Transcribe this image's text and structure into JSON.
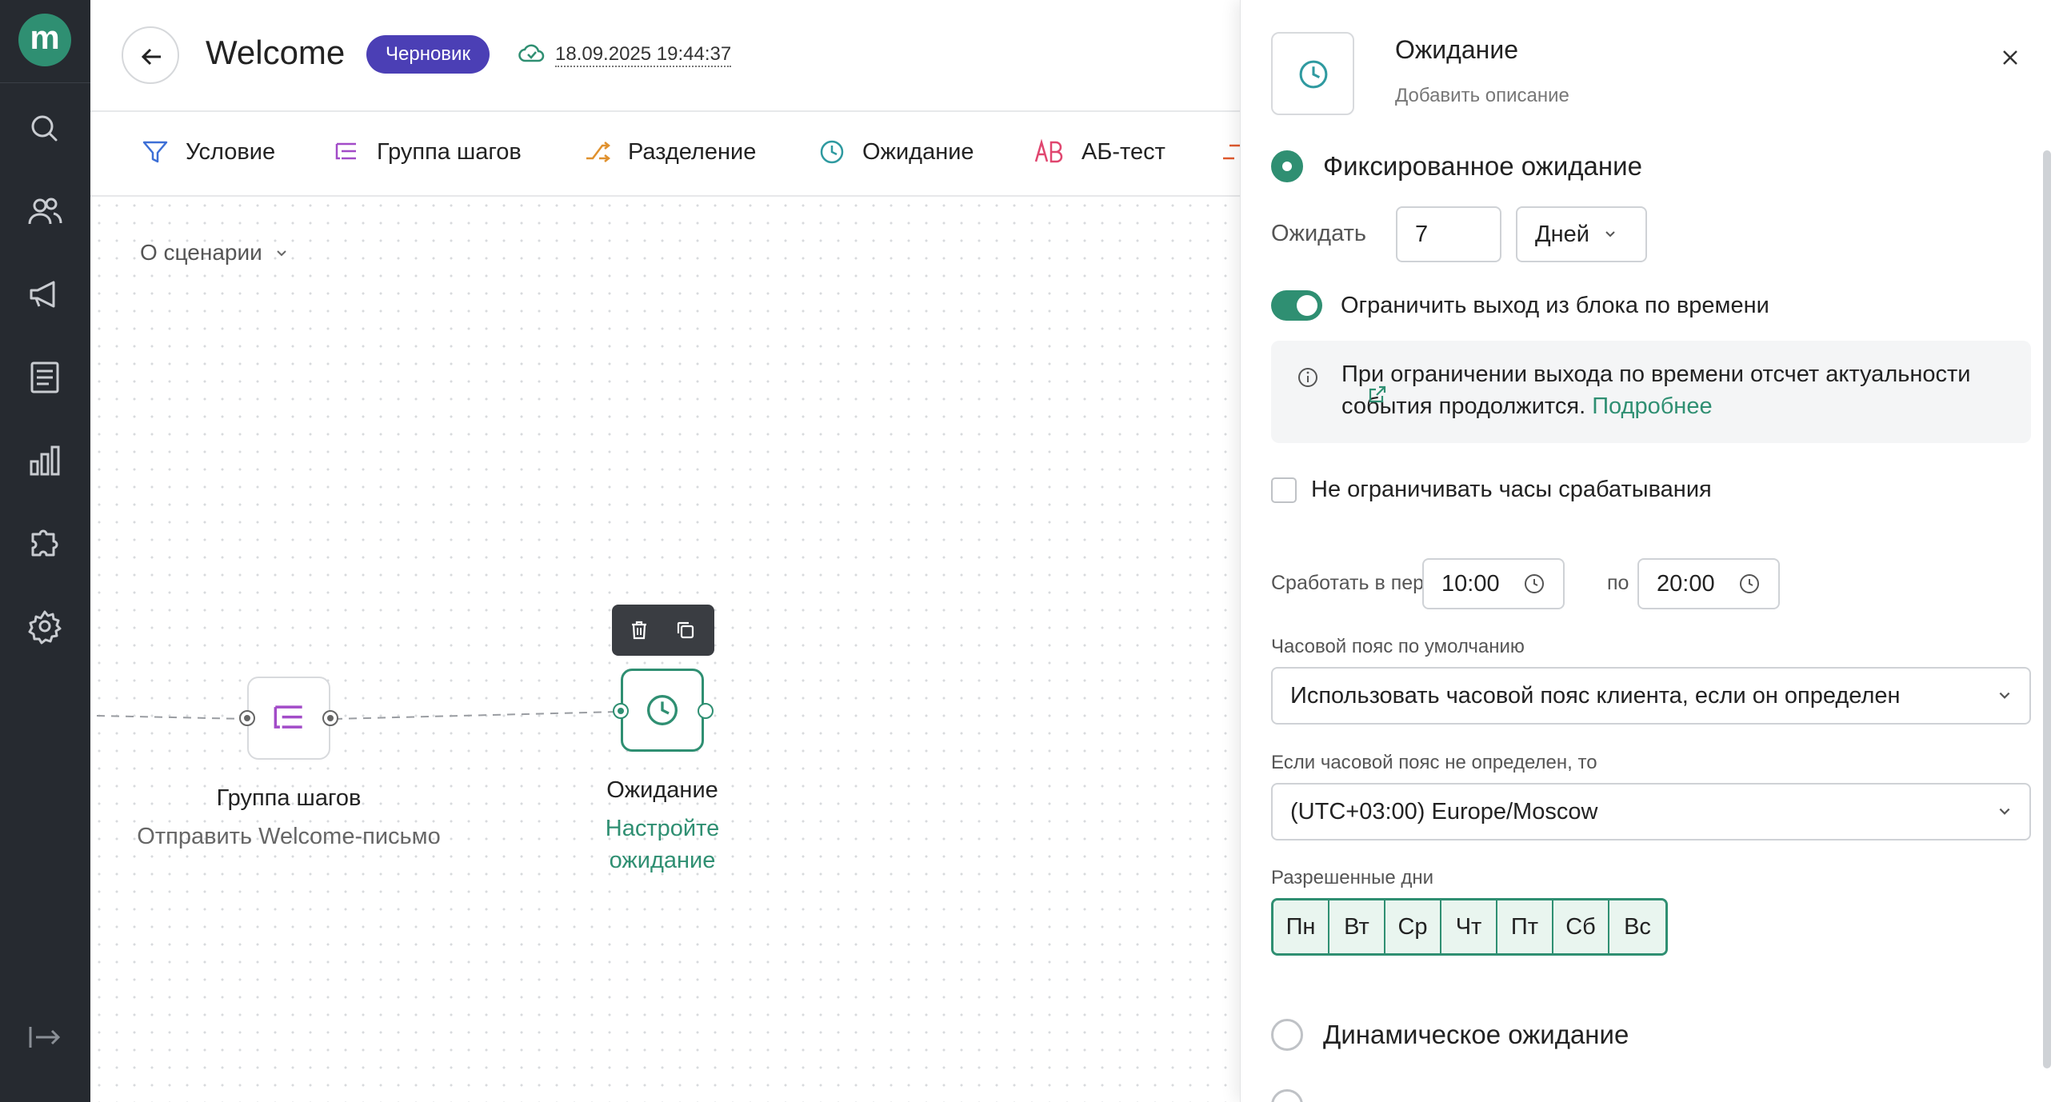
{
  "sidebar": {
    "logo": "m",
    "icons": [
      "search-icon",
      "users-icon",
      "megaphone-icon",
      "document-icon",
      "chart-icon",
      "puzzle-icon",
      "gear-icon",
      "logout-icon"
    ]
  },
  "header": {
    "title": "Welcome",
    "badge": "Черновик",
    "saved_at": "18.09.2025 19:44:37"
  },
  "toolbar": {
    "items": [
      "Условие",
      "Группа шагов",
      "Разделение",
      "Ожидание",
      "АБ-тест"
    ]
  },
  "canvas": {
    "about_label": "О сценарии",
    "nodes": [
      {
        "title": "Группа шагов",
        "subtitle": "Отправить Welcome-письмо"
      },
      {
        "title": "Ожидание",
        "subtitle_line1": "Настройте",
        "subtitle_line2": "ожидание"
      }
    ]
  },
  "panel": {
    "title": "Ожидание",
    "description": "Добавить описание",
    "fixed_wait_label": "Фиксированное ожидание",
    "wait_label": "Ожидать",
    "wait_value": "7",
    "wait_unit": "Дней",
    "limit_toggle_label": "Ограничить выход из блока по времени",
    "info_text": "При ограничении выхода по времени отсчет актуальности события продолжится.",
    "info_link": "Подробнее",
    "no_limit_hours_label": "Не ограничивать часы срабатывания",
    "period_label": "Сработать в период с",
    "period_from": "10:00",
    "period_to_label": "по",
    "period_to": "20:00",
    "tz_default_label": "Часовой пояс по умолчанию",
    "tz_default_value": "Использовать часовой пояс клиента, если он определен",
    "tz_fallback_label": "Если часовой пояс не определен, то",
    "tz_fallback_value": "(UTC+03:00) Europe/Moscow",
    "allowed_days_label": "Разрешенные дни",
    "days": [
      "Пн",
      "Вт",
      "Ср",
      "Чт",
      "Пт",
      "Сб",
      "Вс"
    ],
    "dynamic_wait_label": "Динамическое ожидание"
  },
  "colors": {
    "accent": "#2f8f72",
    "badge": "#4b3fb5",
    "sidebar": "#262a30"
  }
}
